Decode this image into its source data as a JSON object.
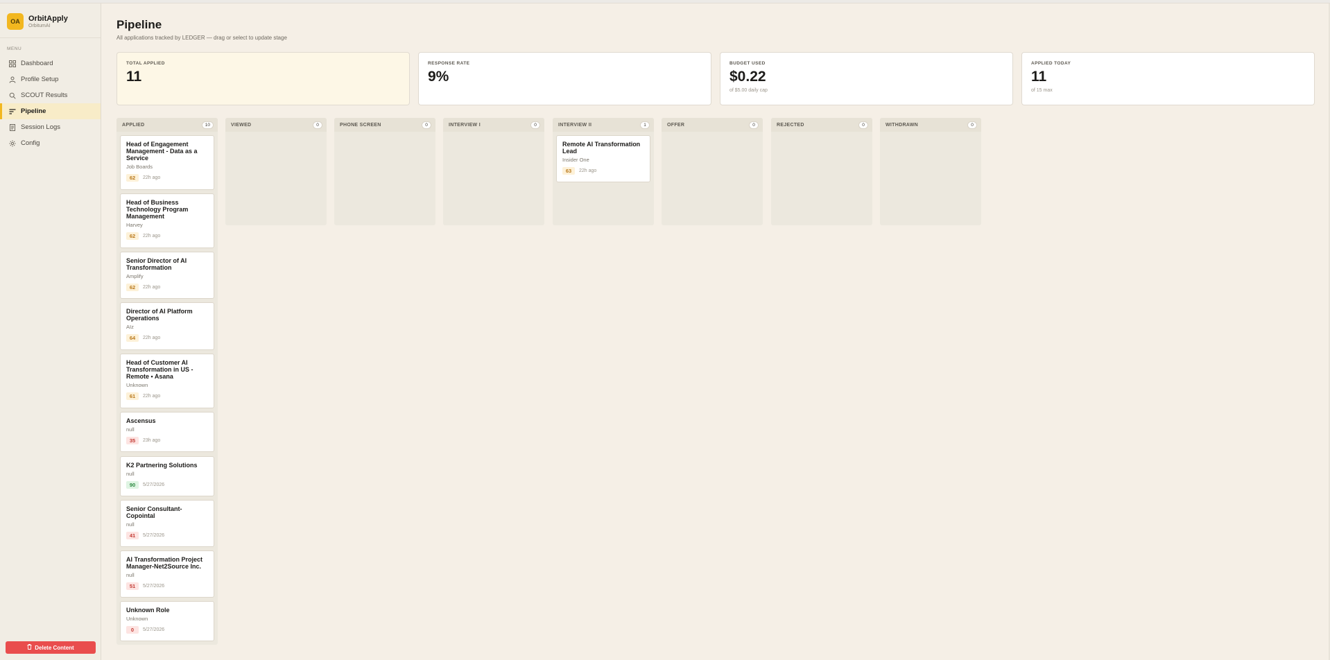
{
  "brand": {
    "logo": "OA",
    "name": "OrbitApply",
    "sub": "OrbitumAI"
  },
  "menu_label": "MENU",
  "nav": [
    {
      "label": "Dashboard",
      "icon": "grid-icon",
      "active": false
    },
    {
      "label": "Profile Setup",
      "icon": "user-icon",
      "active": false
    },
    {
      "label": "SCOUT Results",
      "icon": "search-icon",
      "active": false
    },
    {
      "label": "Pipeline",
      "icon": "pipeline-icon",
      "active": true
    },
    {
      "label": "Session Logs",
      "icon": "document-icon",
      "active": false
    },
    {
      "label": "Config",
      "icon": "gear-icon",
      "active": false
    }
  ],
  "delete_label": "Delete Content",
  "page": {
    "title": "Pipeline",
    "subtitle": "All applications tracked by LEDGER — drag or select to update stage"
  },
  "stats": [
    {
      "label": "TOTAL APPLIED",
      "value": "11",
      "note": ""
    },
    {
      "label": "RESPONSE RATE",
      "value": "9%",
      "note": ""
    },
    {
      "label": "BUDGET USED",
      "value": "$0.22",
      "note": "of $5.00 daily cap"
    },
    {
      "label": "APPLIED TODAY",
      "value": "11",
      "note": "of 15 max"
    }
  ],
  "columns": [
    {
      "title": "APPLIED",
      "count": "10",
      "cards": [
        {
          "title": "Head of Engagement Management - Data as a Service",
          "company": "Job Boards",
          "score": "62",
          "level": "mid",
          "time": "22h ago"
        },
        {
          "title": "Head of Business Technology Program Management",
          "company": "Harvey",
          "score": "62",
          "level": "mid",
          "time": "22h ago"
        },
        {
          "title": "Senior Director of AI Transformation",
          "company": "Amplify",
          "score": "62",
          "level": "mid",
          "time": "22h ago"
        },
        {
          "title": "Director of AI Platform Operations",
          "company": "AIz",
          "score": "64",
          "level": "mid",
          "time": "22h ago"
        },
        {
          "title": "Head of Customer AI Transformation in US - Remote • Asana",
          "company": "Unknown",
          "score": "61",
          "level": "mid",
          "time": "22h ago"
        },
        {
          "title": "Ascensus",
          "company": "null",
          "score": "35",
          "level": "low",
          "time": "23h ago"
        },
        {
          "title": "K2 Partnering Solutions",
          "company": "null",
          "score": "90",
          "level": "high",
          "time": "5/27/2026"
        },
        {
          "title": "Senior Consultant-Copointal",
          "company": "null",
          "score": "41",
          "level": "low",
          "time": "5/27/2026"
        },
        {
          "title": "AI Transformation Project Manager-Net2Source Inc.",
          "company": "null",
          "score": "51",
          "level": "low",
          "time": "5/27/2026"
        },
        {
          "title": "Unknown Role",
          "company": "Unknown",
          "score": "0",
          "level": "low",
          "time": "5/27/2026"
        }
      ]
    },
    {
      "title": "VIEWED",
      "count": "0",
      "cards": []
    },
    {
      "title": "PHONE SCREEN",
      "count": "0",
      "cards": []
    },
    {
      "title": "INTERVIEW I",
      "count": "0",
      "cards": []
    },
    {
      "title": "INTERVIEW II",
      "count": "1",
      "cards": [
        {
          "title": "Remote AI Transformation Lead",
          "company": "Insider One",
          "score": "63",
          "level": "mid",
          "time": "22h ago"
        }
      ]
    },
    {
      "title": "OFFER",
      "count": "0",
      "cards": []
    },
    {
      "title": "REJECTED",
      "count": "0",
      "cards": []
    },
    {
      "title": "WITHDRAWN",
      "count": "0",
      "cards": []
    }
  ]
}
